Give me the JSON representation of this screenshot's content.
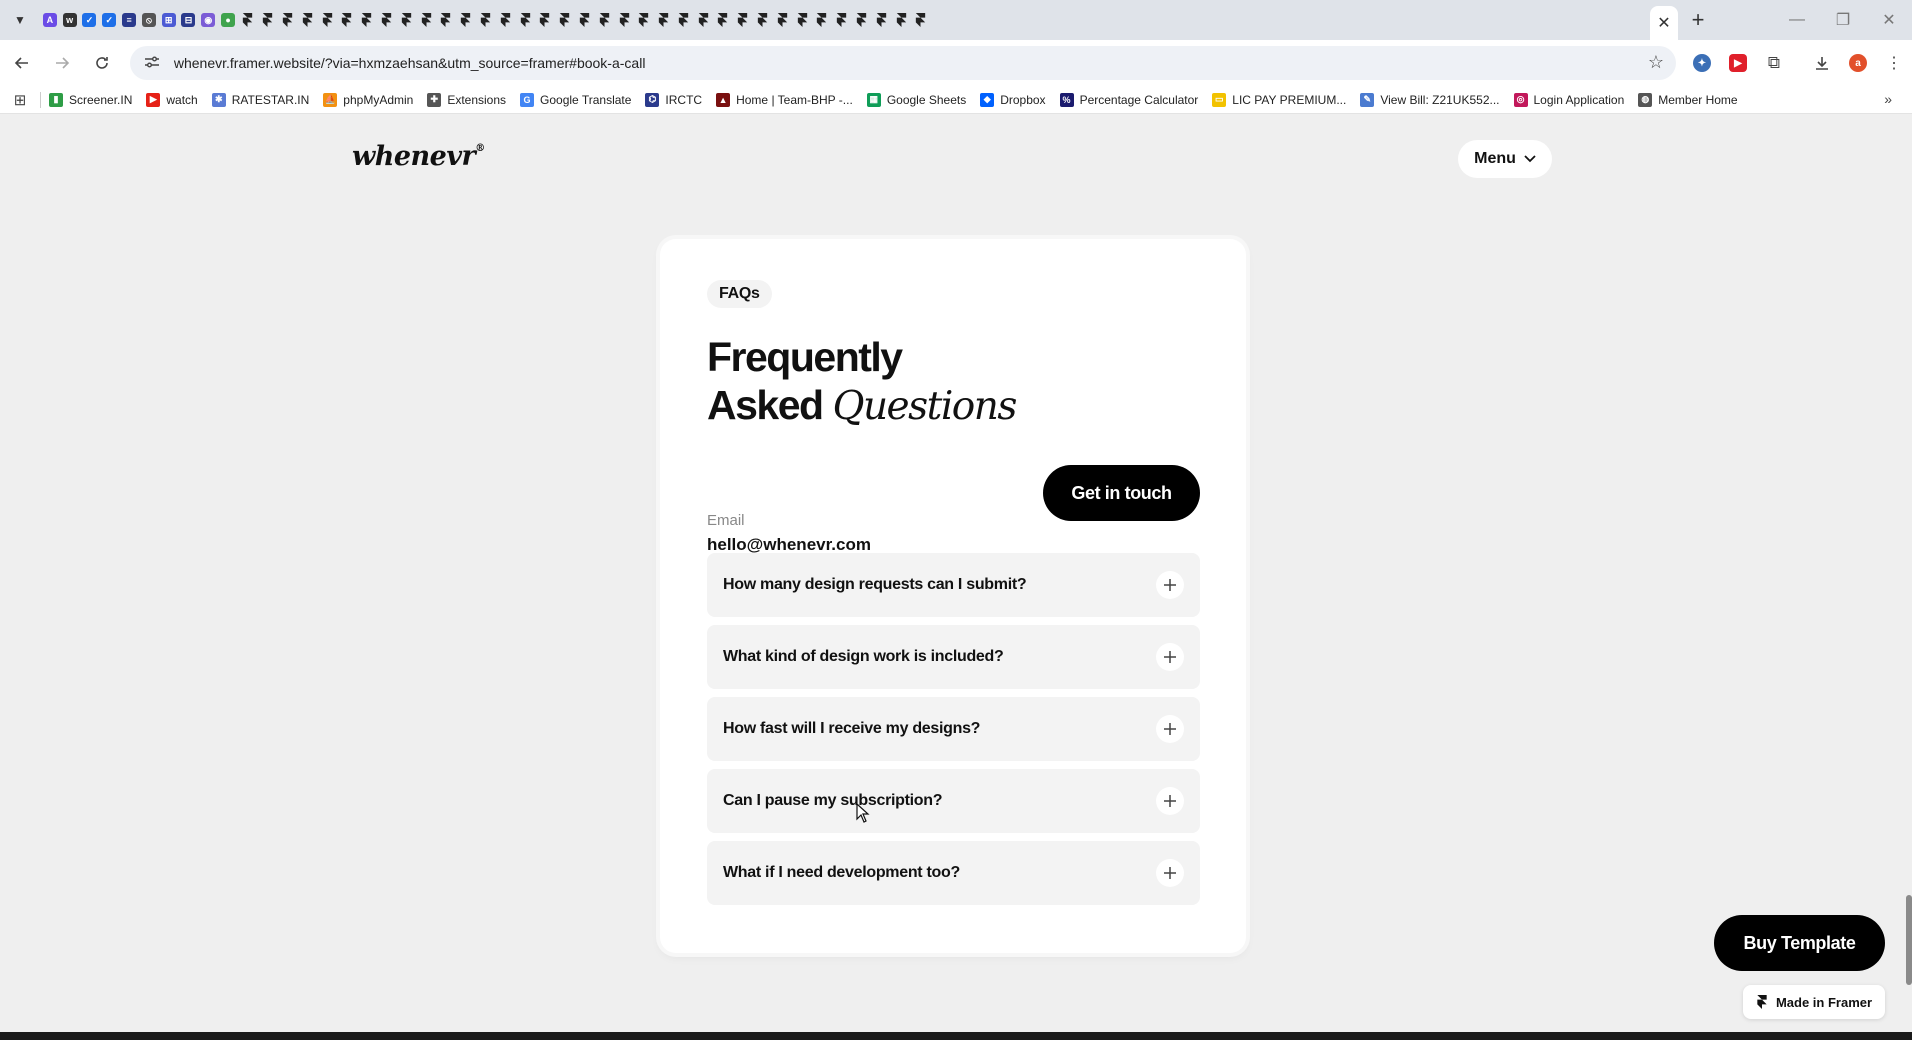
{
  "browser": {
    "tab_icons": [
      {
        "icon": "arc-icon",
        "color": "#6b4ce6",
        "glyph": "A"
      },
      {
        "icon": "wix-icon",
        "color": "#333333",
        "glyph": "w"
      },
      {
        "icon": "tile-icon",
        "color": "#1e6fe8",
        "glyph": "✓"
      },
      {
        "icon": "tile-icon",
        "color": "#1e6fe8",
        "glyph": "✓"
      },
      {
        "icon": "tile-icon",
        "color": "#2a3a8c",
        "glyph": "≡"
      },
      {
        "icon": "stripe-icon",
        "color": "#555555",
        "glyph": "⦸"
      },
      {
        "icon": "tile-icon",
        "color": "#4c5bd4",
        "glyph": "⊞"
      },
      {
        "icon": "tile-icon",
        "color": "#2a3a8c",
        "glyph": "⊟"
      },
      {
        "icon": "circle-icon",
        "color": "#7b5cd6",
        "glyph": "◉"
      },
      {
        "icon": "circle-icon",
        "color": "#3fa34d",
        "glyph": "●"
      }
    ],
    "framer_tab_count": 35,
    "active_tab_close": "✕",
    "new_tab": "+",
    "window_buttons": [
      "—",
      "❐",
      "✕"
    ],
    "url": "whenevr.framer.website/?via=hxmzaehsan&utm_source=framer#book-a-call",
    "profile_initial": "a",
    "bookmarks": [
      {
        "label": "Screener.IN",
        "icon": "chart-icon",
        "color": "#2e9d46",
        "glyph": "▮"
      },
      {
        "label": "watch",
        "icon": "youtube-icon",
        "color": "#e62117",
        "glyph": "▶"
      },
      {
        "label": "RATESTAR.IN",
        "icon": "ratestar-icon",
        "color": "#5a7bd4",
        "glyph": "✱"
      },
      {
        "label": "phpMyAdmin",
        "icon": "phpmyadmin-icon",
        "color": "#f29111",
        "glyph": "⛵"
      },
      {
        "label": "Extensions",
        "icon": "puzzle-icon",
        "color": "#555555",
        "glyph": "✚"
      },
      {
        "label": "Google Translate",
        "icon": "translate-icon",
        "color": "#4285f4",
        "glyph": "G"
      },
      {
        "label": "IRCTC",
        "icon": "irctc-icon",
        "color": "#2b3a8c",
        "glyph": "⌬"
      },
      {
        "label": "Home | Team-BHP -...",
        "icon": "teambhp-icon",
        "color": "#7a1010",
        "glyph": "▲"
      },
      {
        "label": "Google Sheets",
        "icon": "sheets-icon",
        "color": "#0f9d58",
        "glyph": "▦"
      },
      {
        "label": "Dropbox",
        "icon": "dropbox-icon",
        "color": "#0061fe",
        "glyph": "◆"
      },
      {
        "label": "Percentage Calculator",
        "icon": "percent-icon",
        "color": "#1b1b6e",
        "glyph": "%"
      },
      {
        "label": "LIC PAY PREMIUM...",
        "icon": "lic-icon",
        "color": "#f2c200",
        "glyph": "▭"
      },
      {
        "label": "View Bill: Z21UK552...",
        "icon": "bill-icon",
        "color": "#4b7bd0",
        "glyph": "✎"
      },
      {
        "label": "Login Application",
        "icon": "login-icon",
        "color": "#c2185b",
        "glyph": "◎"
      },
      {
        "label": "Member Home",
        "icon": "globe-icon",
        "color": "#555555",
        "glyph": "◍"
      }
    ]
  },
  "site": {
    "logo": "whenevr",
    "logo_mark": "®",
    "menu_label": "Menu"
  },
  "faq_section": {
    "badge": "FAQs",
    "title_line1": "Frequently",
    "title_line2_plain": "Asked",
    "title_line2_italic": "Questions",
    "email_label": "Email",
    "email_value": "hello@whenevr.com",
    "cta_label": "Get in touch",
    "questions": [
      "How many design requests can I submit?",
      "What kind of design work is included?",
      "How fast will I receive my designs?",
      "Can I pause my subscription?",
      "What if I need development too?"
    ]
  },
  "floating": {
    "buy_label": "Buy Template",
    "made_in_label": "Made in Framer"
  }
}
